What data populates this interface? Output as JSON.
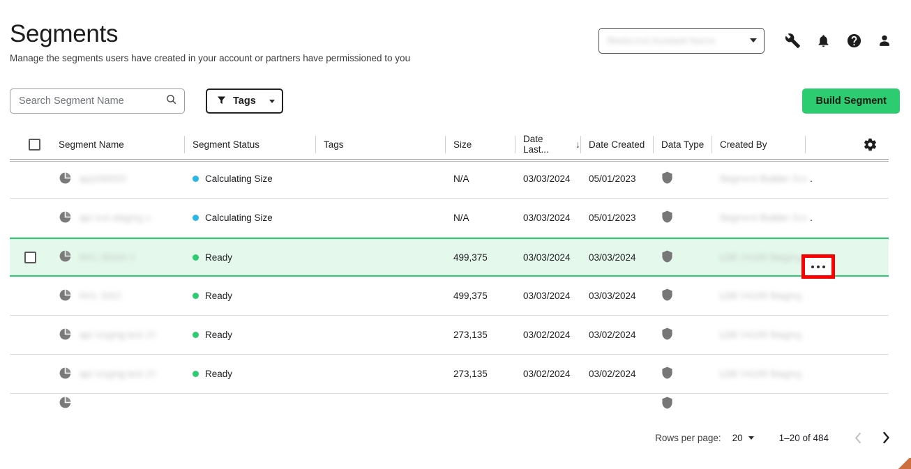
{
  "header": {
    "title": "Segments",
    "subtitle": "Manage the segments users have created in your account or partners have permissioned to you",
    "account_selector": {
      "value": "",
      "redacted": true
    },
    "icons": [
      "wrench-icon",
      "bell-icon",
      "help-icon",
      "account-icon"
    ]
  },
  "toolbar": {
    "search_placeholder": "Search Segment Name",
    "search_value": "",
    "tags_label": "Tags",
    "build_label": "Build Segment"
  },
  "table": {
    "columns": [
      {
        "key": "check",
        "label": ""
      },
      {
        "key": "name",
        "label": "Segment Name"
      },
      {
        "key": "status",
        "label": "Segment Status"
      },
      {
        "key": "tags",
        "label": "Tags"
      },
      {
        "key": "size",
        "label": "Size"
      },
      {
        "key": "dlast",
        "label": "Date Last...",
        "sorted": "desc"
      },
      {
        "key": "dcreat",
        "label": "Date Created"
      },
      {
        "key": "dtype",
        "label": "Data Type"
      },
      {
        "key": "by",
        "label": "Created By"
      }
    ],
    "rows": [
      {
        "name": "redacted",
        "status": "Calculating Size",
        "status_color": "#29b6e8",
        "tags": "",
        "size": "N/A",
        "date_last": "03/03/2024",
        "date_created": "05/01/2023",
        "data_type": "shield-icon",
        "created_by": "redacted",
        "created_by_suffix": ".",
        "selected": false,
        "checkbox_visible": false
      },
      {
        "name": "redacted",
        "status": "Calculating Size",
        "status_color": "#29b6e8",
        "tags": "",
        "size": "N/A",
        "date_last": "03/03/2024",
        "date_created": "05/01/2023",
        "data_type": "shield-icon",
        "created_by": "redacted",
        "created_by_suffix": ".",
        "selected": false,
        "checkbox_visible": false
      },
      {
        "name": "redacted",
        "status": "Ready",
        "status_color": "#2ecc71",
        "tags": "",
        "size": "499,375",
        "date_last": "03/03/2024",
        "date_created": "03/03/2024",
        "data_type": "shield-icon",
        "created_by": "redacted",
        "created_by_suffix": "",
        "selected": true,
        "checkbox_visible": true
      },
      {
        "name": "redacted",
        "status": "Ready",
        "status_color": "#2ecc71",
        "tags": "",
        "size": "499,375",
        "date_last": "03/03/2024",
        "date_created": "03/03/2024",
        "data_type": "shield-icon",
        "created_by": "redacted",
        "created_by_suffix": "",
        "selected": false,
        "checkbox_visible": false
      },
      {
        "name": "redacted",
        "status": "Ready",
        "status_color": "#2ecc71",
        "tags": "",
        "size": "273,135",
        "date_last": "03/02/2024",
        "date_created": "03/02/2024",
        "data_type": "shield-icon",
        "created_by": "redacted",
        "created_by_suffix": "",
        "selected": false,
        "checkbox_visible": false
      },
      {
        "name": "redacted",
        "status": "Ready",
        "status_color": "#2ecc71",
        "tags": "",
        "size": "273,135",
        "date_last": "03/02/2024",
        "date_created": "03/02/2024",
        "data_type": "shield-icon",
        "created_by": "redacted",
        "created_by_suffix": "",
        "selected": false,
        "checkbox_visible": false
      }
    ],
    "row_action_label": "•••",
    "settings_icon": "gear-icon"
  },
  "pagination": {
    "rows_per_page_label": "Rows per page:",
    "rows_per_page_value": "20",
    "range_text": "1–20 of 484",
    "prev_enabled": false,
    "next_enabled": true
  },
  "colors": {
    "accent_green": "#2ecc71",
    "selected_row_bg": "#e4f9ec",
    "status_calculating": "#29b6e8",
    "status_ready": "#2ecc71",
    "annotation_red": "#fb0000"
  }
}
